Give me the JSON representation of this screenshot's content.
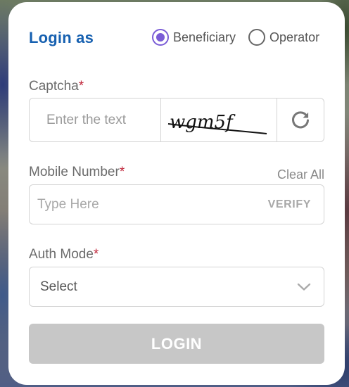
{
  "login_panel": {
    "title": "Login as",
    "role_options": [
      {
        "label": "Beneficiary",
        "selected": true
      },
      {
        "label": "Operator",
        "selected": false
      }
    ],
    "accent_color": "#7a5cd6",
    "title_color": "#1660b0"
  },
  "captcha": {
    "label": "Captcha",
    "required_mark": "*",
    "placeholder": "Enter the text",
    "image_text": "wgm5f",
    "refresh_icon": "refresh-icon"
  },
  "mobile": {
    "label": "Mobile Number",
    "required_mark": "*",
    "clear_label": "Clear All",
    "placeholder": "Type Here",
    "verify_label": "VERIFY"
  },
  "auth_mode": {
    "label": "Auth Mode",
    "required_mark": "*",
    "selected_value": "Select",
    "dropdown_icon": "chevron-down-icon"
  },
  "login_button": {
    "label": "LOGIN"
  }
}
